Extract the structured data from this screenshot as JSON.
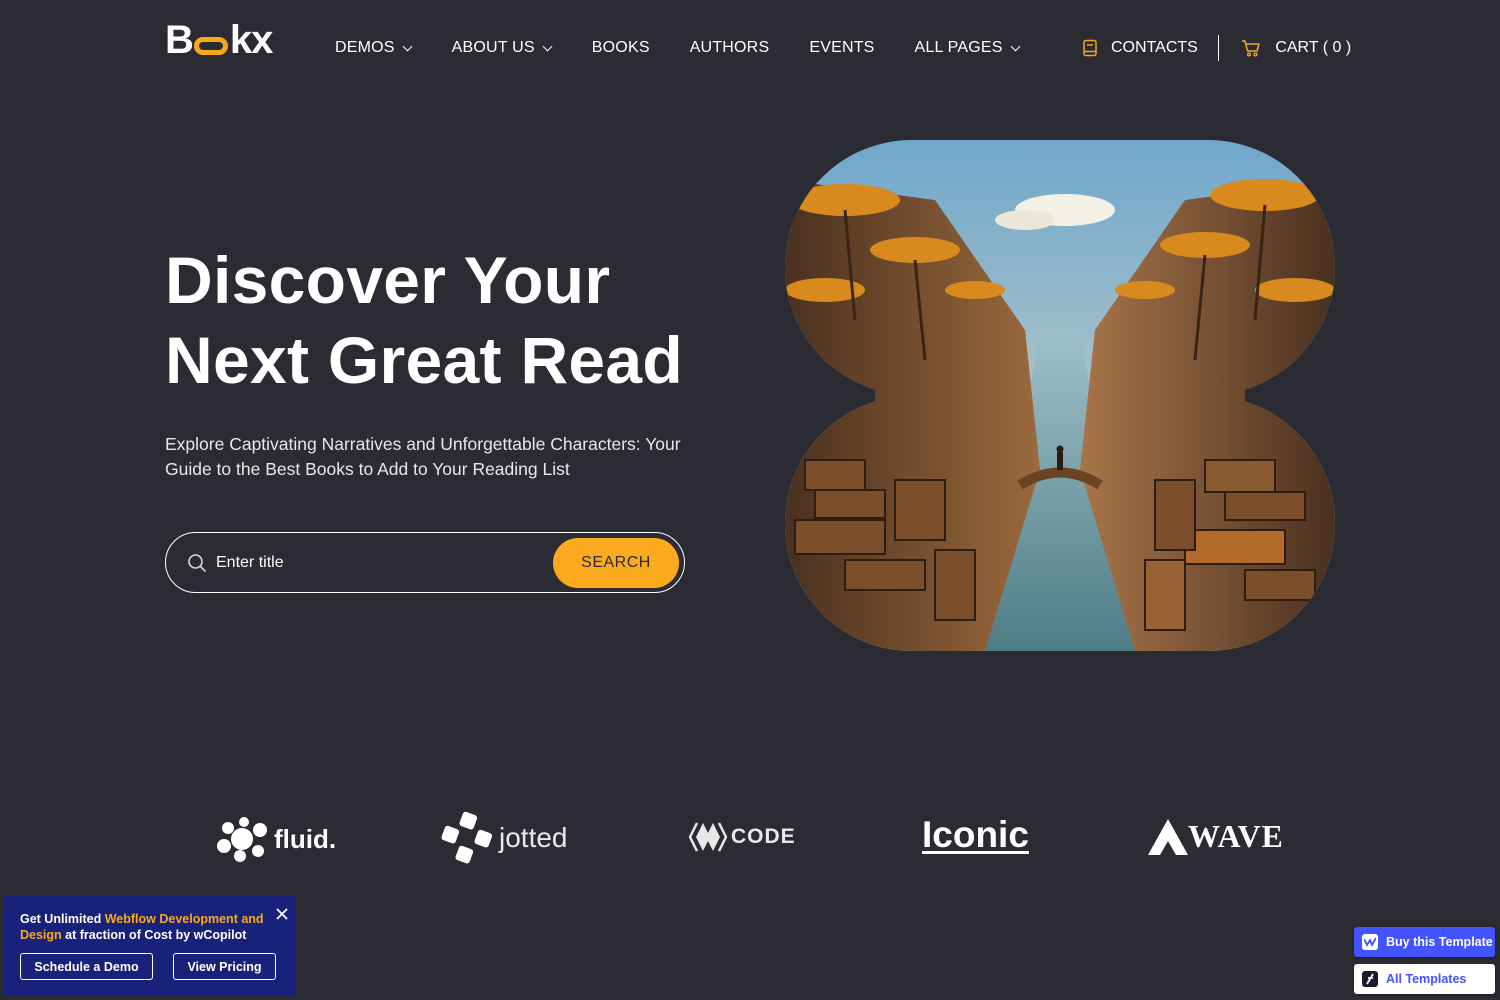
{
  "nav": {
    "logo_prefix": "B",
    "logo_suffix": "kx",
    "items": [
      {
        "label": "DEMOS",
        "has_dropdown": true
      },
      {
        "label": "ABOUT US",
        "has_dropdown": true
      },
      {
        "label": "BOOKS",
        "has_dropdown": false
      },
      {
        "label": "AUTHORS",
        "has_dropdown": false
      },
      {
        "label": "EVENTS",
        "has_dropdown": false
      },
      {
        "label": "ALL PAGES",
        "has_dropdown": true
      }
    ],
    "contacts_label": "CONTACTS",
    "cart_label": "CART ( 0 )"
  },
  "hero": {
    "title_line1": "Discover Your",
    "title_line2": "Next Great Read",
    "subtitle": "Explore Captivating Narratives and Unforgettable Characters: Your Guide to the Best Books to Add to Your Reading List",
    "search_placeholder": "Enter title",
    "search_button": "SEARCH"
  },
  "brands": {
    "fluid": "fluid.",
    "jotted": "jotted",
    "code": "CODE",
    "iconic": "Iconic",
    "wave": "WAVE"
  },
  "promo": {
    "text_1": "Get Unlimited ",
    "text_highlight": "Webflow Development and Design",
    "text_2": " at fraction of Cost by wCopilot",
    "button_demo": "Schedule a Demo",
    "button_pricing": "View Pricing"
  },
  "template_buttons": {
    "buy": "Buy this Template",
    "all": "All Templates"
  },
  "colors": {
    "background": "#2b2c33",
    "accent": "#fbaa1d",
    "promo_bg": "#19227a",
    "webflow_blue": "#4353ff"
  },
  "icons": {
    "contacts": "book-icon",
    "cart": "cart-icon",
    "search": "search-icon",
    "close": "close-icon"
  }
}
